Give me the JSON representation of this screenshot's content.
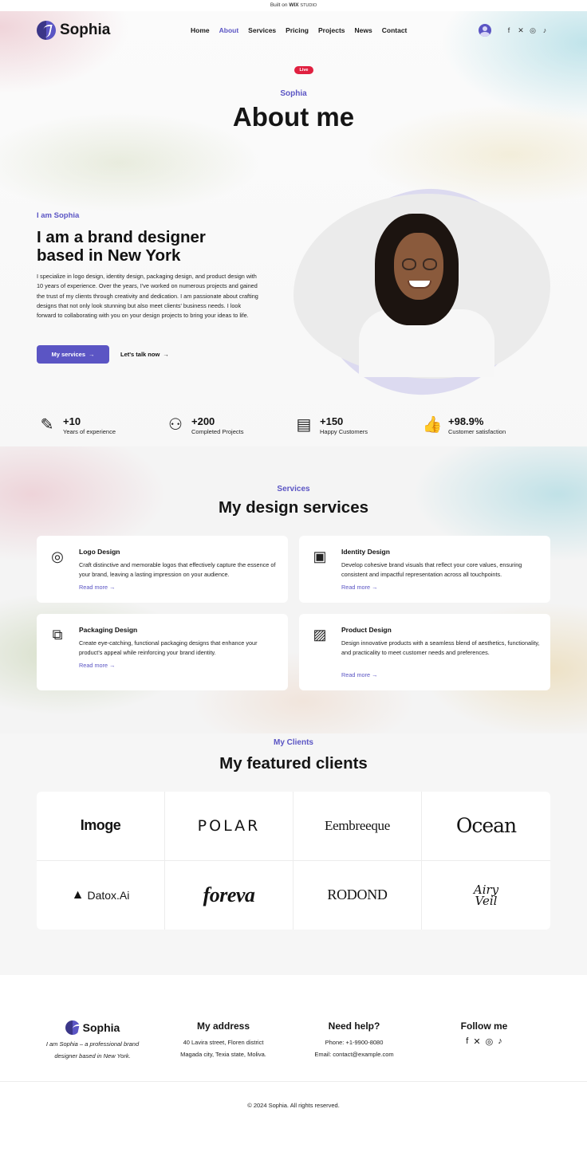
{
  "topbar": {
    "built_on": "Built on",
    "brand": "WIX",
    "studio": "STUDIO"
  },
  "header": {
    "logo_text": "Sophia",
    "nav": [
      {
        "label": "Home",
        "active": false
      },
      {
        "label": "About",
        "active": true
      },
      {
        "label": "Services",
        "active": false
      },
      {
        "label": "Pricing",
        "active": false
      },
      {
        "label": "Projects",
        "active": false
      },
      {
        "label": "News",
        "active": false
      },
      {
        "label": "Contact",
        "active": false
      }
    ],
    "socials": [
      "facebook-icon",
      "x-icon",
      "instagram-icon",
      "tiktok-icon"
    ]
  },
  "hero": {
    "live_badge": "Live",
    "eyebrow": "Sophia",
    "title": "About me"
  },
  "intro": {
    "eyebrow": "I am Sophia",
    "heading": "I am a brand designer based in New York",
    "paragraph": "I specialize in logo design, identity design, packaging design, and product design with 10 years of experience. Over the years, I've worked on numerous projects and gained the trust of my clients through creativity and dedication. I am passionate about crafting designs that not only look stunning but also meet clients' business needs. I look forward to collaborating with you on your design projects to bring your ideas to life.",
    "primary_button": "My services",
    "secondary_link": "Let's talk now",
    "arrow": "→"
  },
  "stats": [
    {
      "icon": "pencil-ruler-icon",
      "value": "+10",
      "label": "Years of experience"
    },
    {
      "icon": "people-icon",
      "value": "+200",
      "label": "Completed Projects"
    },
    {
      "icon": "document-check-icon",
      "value": "+150",
      "label": "Happy Customers"
    },
    {
      "icon": "thumbs-up-icon",
      "value": "+98.9%",
      "label": "Customer satisfaction"
    }
  ],
  "services": {
    "eyebrow": "Services",
    "title": "My design services",
    "cards": [
      {
        "icon": "logo-design-icon",
        "title": "Logo Design",
        "description": "Craft distinctive and memorable logos that effectively capture the essence of your brand, leaving a lasting impression on your audience.",
        "link": "Read more →"
      },
      {
        "icon": "identity-design-icon",
        "title": "Identity Design",
        "description": "Develop cohesive brand visuals that reflect your core values, ensuring consistent and impactful representation across all touchpoints.",
        "link": "Read more →"
      },
      {
        "icon": "packaging-design-icon",
        "title": "Packaging Design",
        "description": "Create eye-catching, functional packaging designs that enhance your product's appeal while reinforcing your brand identity.",
        "link": "Read more →"
      },
      {
        "icon": "product-design-icon",
        "title": "Product Design",
        "description": "Design innovative products with a seamless blend of aesthetics, functionality, and practicality to meet customer needs and preferences.",
        "link": "Read more →"
      }
    ]
  },
  "clients": {
    "eyebrow": "My Clients",
    "title": "My featured clients",
    "logos": [
      "Imoge",
      "POLAR",
      "Eembreeque",
      "Ocean",
      "Datox.Ai",
      "foreva",
      "RODOND",
      "Airy Veil"
    ]
  },
  "footer": {
    "logo_text": "Sophia",
    "tagline": "I am Sophia – a professional brand designer based in New York.",
    "address_title": "My address",
    "address_line1": "40 Lavira street,  Floren district",
    "address_line2": "Magada city, Texia state, Moliva.",
    "help_title": "Need help?",
    "phone": "Phone: +1-9900-8080",
    "email": "Email: contact@example.com",
    "follow_title": "Follow me",
    "copyright": "© 2024 Sophia. All rights reserved."
  }
}
